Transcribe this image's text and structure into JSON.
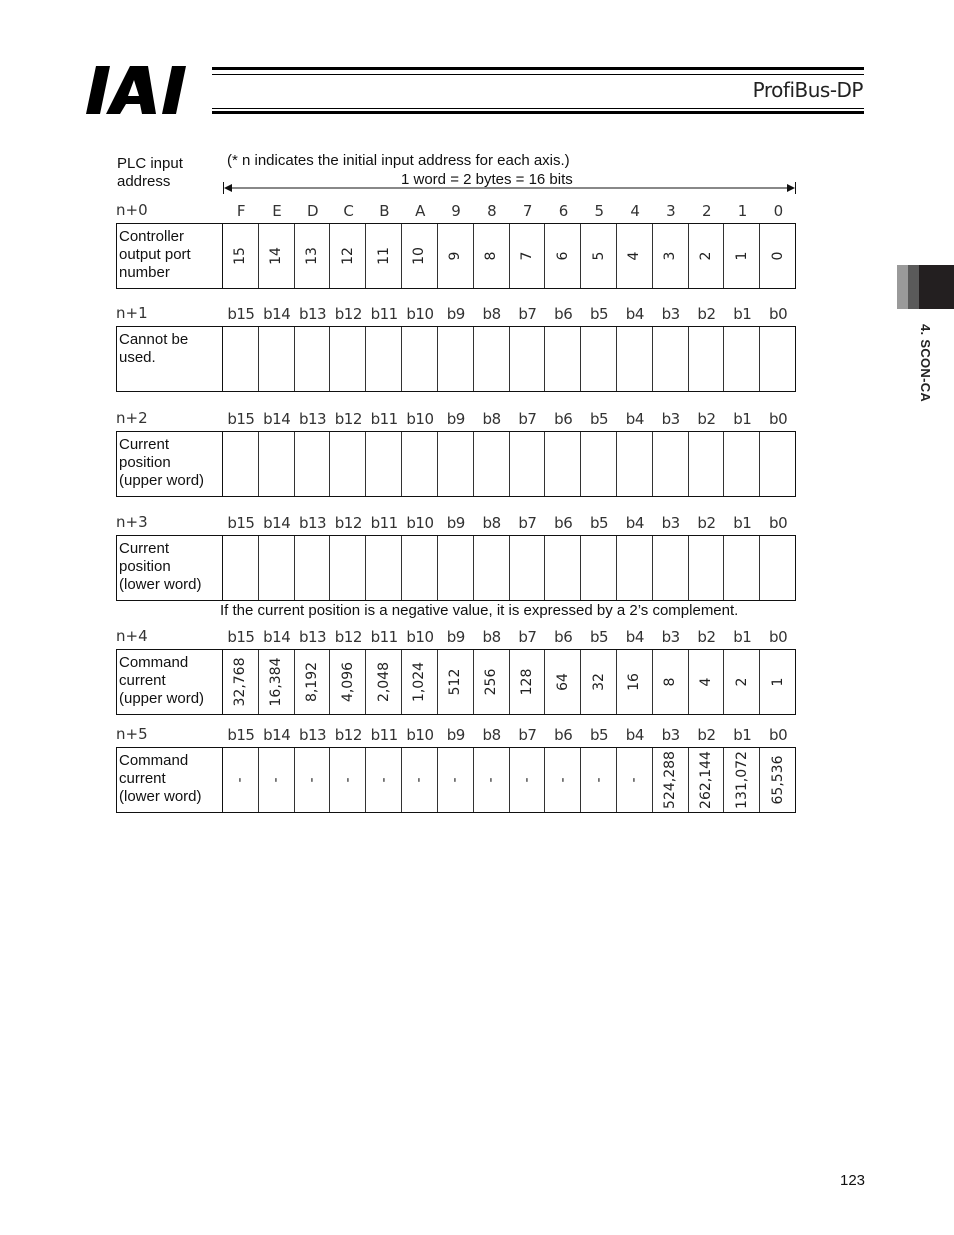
{
  "header": {
    "logo_text": "IAI",
    "title": "ProfiBus-DP"
  },
  "side_tab": {
    "label": "4. SCON-CA",
    "colors": [
      "#9a9a9a",
      "#5a5a5a",
      "#231f20"
    ]
  },
  "page_number": "123",
  "diagram": {
    "plc_label_line1": "PLC input",
    "plc_label_line2": "address",
    "note": "(* n indicates the initial input address for each axis.)",
    "word_note": "1 word = 2 bytes = 16 bits",
    "negative_note": "If the current position is a negative value, it is expressed by a 2’s complement.",
    "words": [
      {
        "address": "n+0",
        "bits": [
          "F",
          "E",
          "D",
          "C",
          "B",
          "A",
          "9",
          "8",
          "7",
          "6",
          "5",
          "4",
          "3",
          "2",
          "1",
          "0"
        ],
        "description": [
          "Controller",
          "output port",
          "number"
        ],
        "values": [
          "15",
          "14",
          "13",
          "12",
          "11",
          "10",
          "9",
          "8",
          "7",
          "6",
          "5",
          "4",
          "3",
          "2",
          "1",
          "0"
        ]
      },
      {
        "address": "n+1",
        "bits": [
          "b15",
          "b14",
          "b13",
          "b12",
          "b11",
          "b10",
          "b9",
          "b8",
          "b7",
          "b6",
          "b5",
          "b4",
          "b3",
          "b2",
          "b1",
          "b0"
        ],
        "description": [
          "Cannot be",
          "used."
        ],
        "values": [
          "",
          "",
          "",
          "",
          "",
          "",
          "",
          "",
          "",
          "",
          "",
          "",
          "",
          "",
          "",
          ""
        ]
      },
      {
        "address": "n+2",
        "bits": [
          "b15",
          "b14",
          "b13",
          "b12",
          "b11",
          "b10",
          "b9",
          "b8",
          "b7",
          "b6",
          "b5",
          "b4",
          "b3",
          "b2",
          "b1",
          "b0"
        ],
        "description": [
          "Current",
          "position",
          "(upper word)"
        ],
        "values": [
          "",
          "",
          "",
          "",
          "",
          "",
          "",
          "",
          "",
          "",
          "",
          "",
          "",
          "",
          "",
          ""
        ]
      },
      {
        "address": "n+3",
        "bits": [
          "b15",
          "b14",
          "b13",
          "b12",
          "b11",
          "b10",
          "b9",
          "b8",
          "b7",
          "b6",
          "b5",
          "b4",
          "b3",
          "b2",
          "b1",
          "b0"
        ],
        "description": [
          "Current",
          "position",
          "(lower word)"
        ],
        "values": [
          "",
          "",
          "",
          "",
          "",
          "",
          "",
          "",
          "",
          "",
          "",
          "",
          "",
          "",
          "",
          ""
        ]
      },
      {
        "address": "n+4",
        "bits": [
          "b15",
          "b14",
          "b13",
          "b12",
          "b11",
          "b10",
          "b9",
          "b8",
          "b7",
          "b6",
          "b5",
          "b4",
          "b3",
          "b2",
          "b1",
          "b0"
        ],
        "description": [
          "Command",
          "current",
          "(upper word)"
        ],
        "values": [
          "32,768",
          "16,384",
          "8,192",
          "4,096",
          "2,048",
          "1,024",
          "512",
          "256",
          "128",
          "64",
          "32",
          "16",
          "8",
          "4",
          "2",
          "1"
        ]
      },
      {
        "address": "n+5",
        "bits": [
          "b15",
          "b14",
          "b13",
          "b12",
          "b11",
          "b10",
          "b9",
          "b8",
          "b7",
          "b6",
          "b5",
          "b4",
          "b3",
          "b2",
          "b1",
          "b0"
        ],
        "description": [
          "Command",
          "current",
          "(lower word)"
        ],
        "values": [
          "-",
          "-",
          "-",
          "-",
          "-",
          "-",
          "-",
          "-",
          "-",
          "-",
          "-",
          "-",
          "524,288",
          "262,144",
          "131,072",
          "65,536"
        ]
      }
    ]
  }
}
